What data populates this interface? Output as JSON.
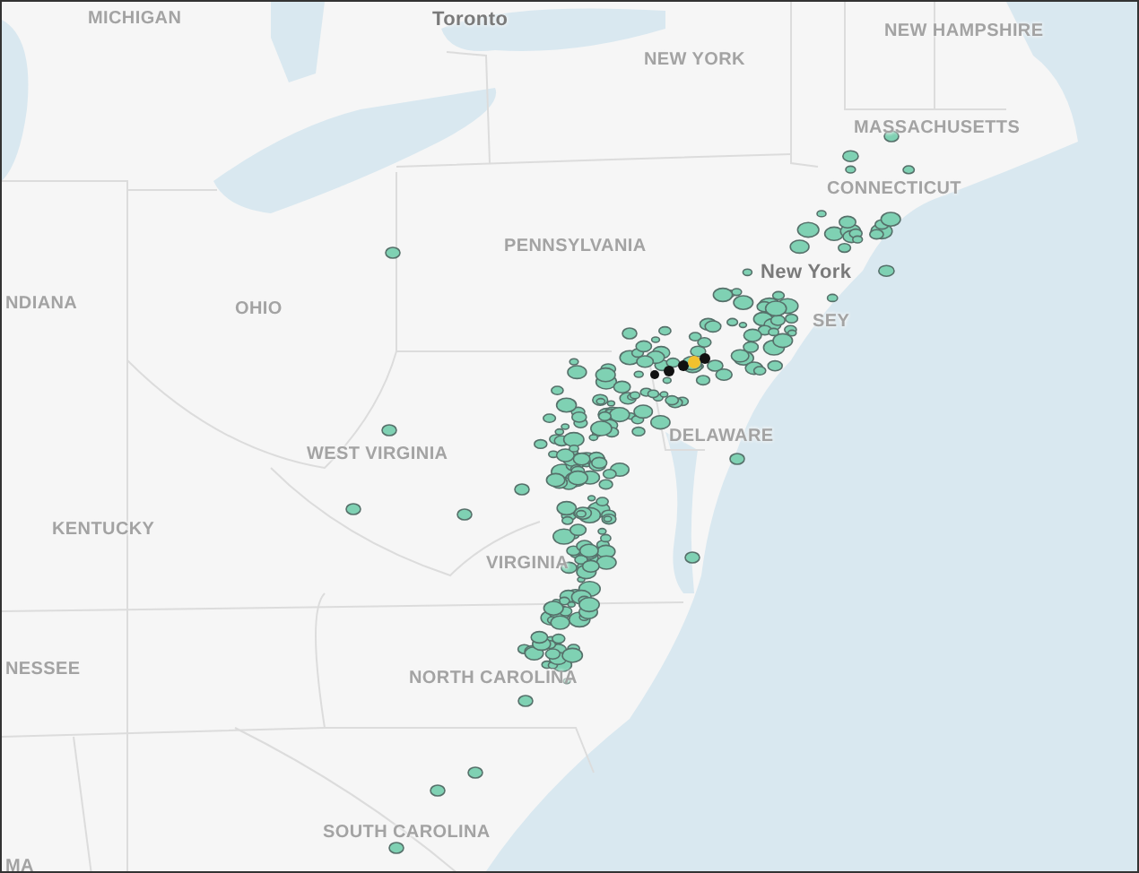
{
  "map": {
    "labels": [
      {
        "text": "MICHIGAN",
        "kind": "region"
      },
      {
        "text": "Toronto",
        "kind": "city"
      },
      {
        "text": "NEW YORK",
        "kind": "region"
      },
      {
        "text": "NEW HAMPSHIRE",
        "kind": "region"
      },
      {
        "text": "MASSACHUSETTS",
        "kind": "region"
      },
      {
        "text": "CONNECTICUT",
        "kind": "region"
      },
      {
        "text": "PENNSYLVANIA",
        "kind": "region"
      },
      {
        "text": "NDIANA",
        "kind": "region"
      },
      {
        "text": "OHIO",
        "kind": "region"
      },
      {
        "text": "New York",
        "kind": "city"
      },
      {
        "text": "SEY",
        "kind": "region"
      },
      {
        "text": "DELAWARE",
        "kind": "region"
      },
      {
        "text": "WEST VIRGINIA",
        "kind": "region"
      },
      {
        "text": "KENTUCKY",
        "kind": "region"
      },
      {
        "text": "VIRGINIA",
        "kind": "region"
      },
      {
        "text": "NESSEE",
        "kind": "region"
      },
      {
        "text": "NORTH CAROLINA",
        "kind": "region"
      },
      {
        "text": "SOUTH CAROLINA",
        "kind": "region"
      },
      {
        "text": "MA",
        "kind": "region"
      }
    ]
  }
}
